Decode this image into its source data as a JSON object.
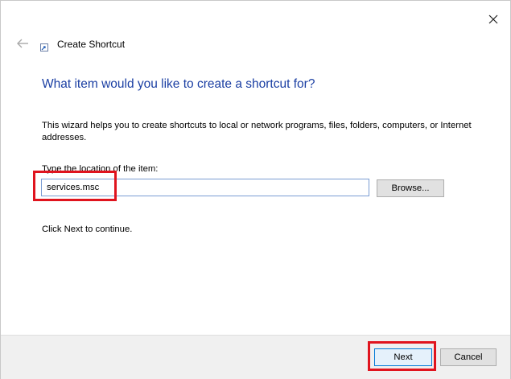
{
  "window": {
    "title": "Create Shortcut",
    "icons": {
      "close": "close-icon",
      "back": "back-arrow-icon",
      "app": "shortcut-app-icon"
    }
  },
  "wizard": {
    "heading": "What item would you like to create a shortcut for?",
    "description": "This wizard helps you to create shortcuts to local or network programs, files, folders, computers, or Internet addresses.",
    "field_label": "Type the location of the item:",
    "location_value": "services.msc",
    "browse_label": "Browse...",
    "continue_text": "Click Next to continue."
  },
  "footer": {
    "next_label": "Next",
    "cancel_label": "Cancel"
  },
  "colors": {
    "heading": "#1b3fa3",
    "highlight": "#e0141e",
    "input_border": "#7a9cd3",
    "default_button_border": "#0078d7"
  }
}
